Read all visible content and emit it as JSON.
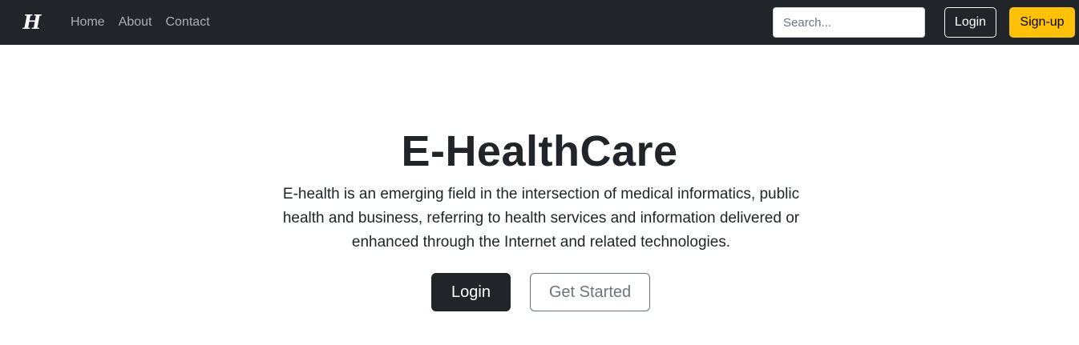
{
  "navbar": {
    "brand_glyph": "H",
    "links": [
      {
        "label": "Home"
      },
      {
        "label": "About"
      },
      {
        "label": "Contact"
      }
    ],
    "search": {
      "placeholder": "Search...",
      "value": ""
    },
    "login_label": "Login",
    "signup_label": "Sign-up"
  },
  "hero": {
    "title": "E-HealthCare",
    "description": "E-health is an emerging field in the intersection of medical informatics, public health and business, referring to health services and information delivered or enhanced through the Internet and related technologies.",
    "login_label": "Login",
    "get_started_label": "Get Started"
  },
  "colors": {
    "navbar_bg": "#212529",
    "signup_accent": "#ffc107",
    "secondary": "#6c757d"
  },
  "icons": {
    "brand": "brand-logo-icon"
  }
}
